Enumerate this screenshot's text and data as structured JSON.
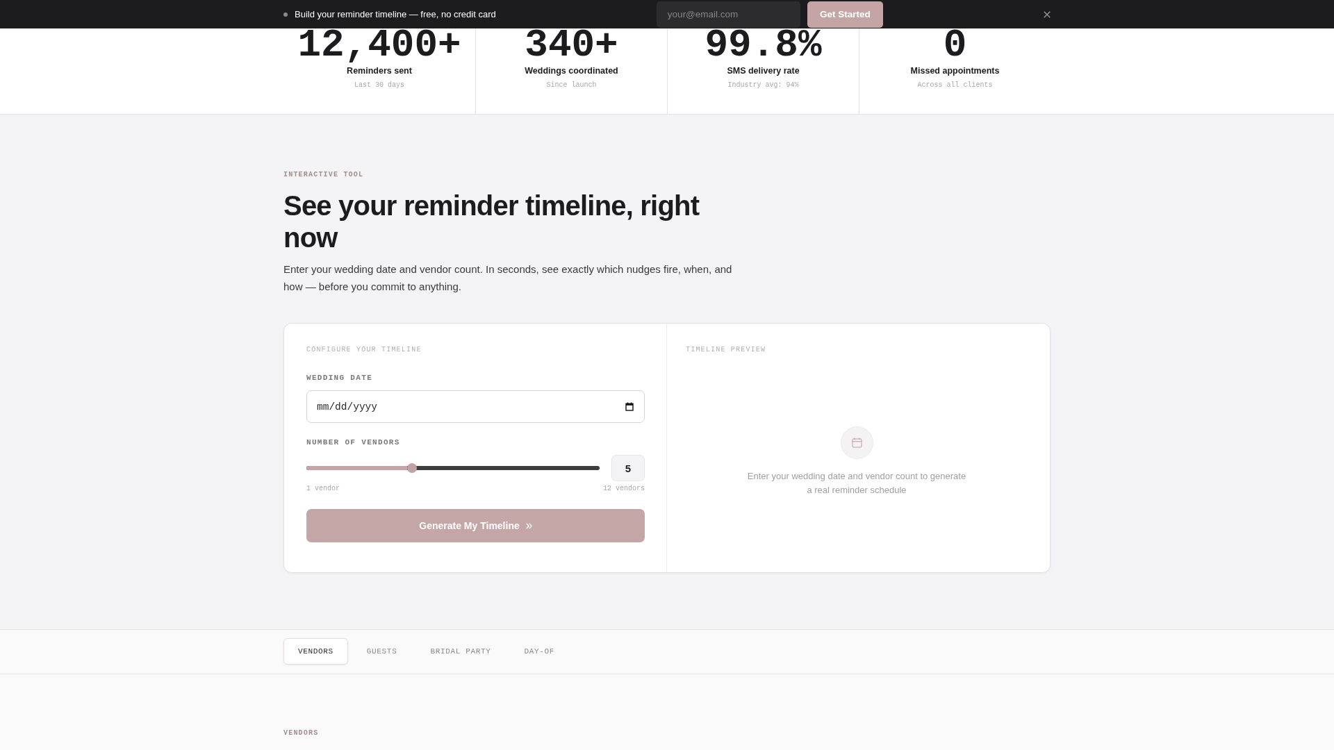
{
  "announcement_bar": {
    "text": "Build your reminder timeline — free, no credit card",
    "email_field": {
      "placeholder": "your@email.com"
    },
    "button": "Get Started"
  },
  "stats": [
    {
      "value": "12,400+",
      "label": "Reminders sent",
      "note": "Last 30 days"
    },
    {
      "value": "340+",
      "label": "Weddings coordinated",
      "note": "Since launch"
    },
    {
      "value": "99.8%",
      "label": "SMS delivery rate",
      "note": "Industry avg: 94%"
    },
    {
      "value": "0",
      "label": "Missed appointments",
      "note": "Across all clients"
    }
  ],
  "tool": {
    "eyebrow": "INTERACTIVE TOOL",
    "title": "See your reminder timeline, right now",
    "intro": "Enter your wedding date and vendor count. In seconds, see exactly which nudges fire, when, and how — before you commit to anything.",
    "config": {
      "heading": "CONFIGURE YOUR TIMELINE",
      "date_label": "WEDDING DATE",
      "date_field": {
        "placeholder": "mm/dd/yyyy"
      },
      "vendors_label": "NUMBER OF VENDORS",
      "slider": {
        "level": 0.36,
        "value": "5",
        "min_label": "1 vendor",
        "max_label": "12 vendors"
      },
      "generate_button": {
        "label": "Generate My Timeline",
        "disabled": true
      }
    },
    "preview": {
      "heading": "TIMELINE PREVIEW",
      "empty_message": "Enter your wedding date and vendor count to generate a real reminder schedule"
    }
  },
  "tabs": [
    {
      "label": "VENDORS",
      "selected": true
    },
    {
      "label": "GUESTS",
      "selected": false
    },
    {
      "label": "BRIDAL PARTY",
      "selected": false
    },
    {
      "label": "DAY-OF",
      "selected": false
    }
  ],
  "section": {
    "eyebrow": "VENDORS"
  }
}
